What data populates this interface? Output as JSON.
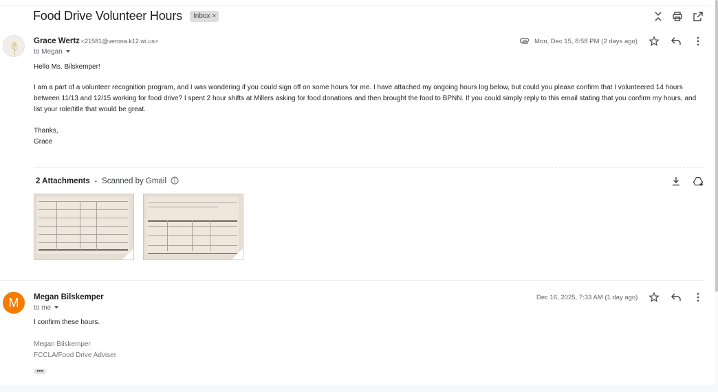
{
  "thread": {
    "subject": "Food Drive Volunteer Hours",
    "label": "Inbox",
    "label_remove": "×"
  },
  "message1": {
    "sender_name": "Grace Wertz",
    "sender_email": "<21581@verona.k12.wi.us>",
    "to": "to Megan",
    "date": "Mon, Dec 15, 8:58 PM (2 days ago)",
    "greeting": "Hello Ms. Bilskemper!",
    "body": "I am a part of a volunteer recognition program, and I was wondering if you could sign off on some hours for me. I have attached my ongoing hours log below, but could you please confirm that I volunteered 14 hours between 11/13 and 12/15 working for food drive? I spent 2 hour shifts at Millers asking for food donations and then brought the food to BPNN. If you could simply reply to this email stating that you confirm my hours, and list your role/title that would be great.",
    "closing": "Thanks,",
    "signoff": "Grace"
  },
  "attachments": {
    "count_label": "2 Attachments",
    "dot": "•",
    "scan_label": "Scanned by Gmail",
    "info_icon": "info-icon"
  },
  "message2": {
    "avatar_letter": "M",
    "sender_name": "Megan Bilskemper",
    "to": "to me",
    "date": "Dec 16, 2025, 7:33 AM (1 day ago)",
    "body": "I confirm these hours.",
    "sig_name": "Megan Bilskemper",
    "sig_title": "FCCLA/Food Drive Adviser",
    "trimmed": "•••"
  },
  "colors": {
    "avatar_m": "#f57c00",
    "label_chip": "#dddddd"
  }
}
